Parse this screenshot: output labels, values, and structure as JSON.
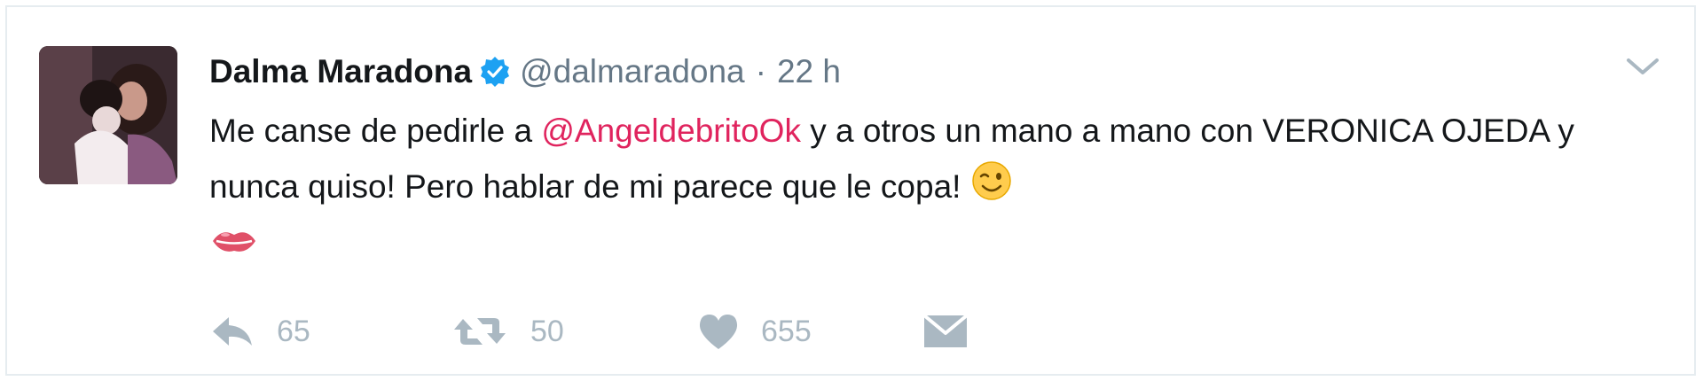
{
  "tweet": {
    "author": {
      "display_name": "Dalma Maradona",
      "screen_name": "@dalmaradona",
      "verified": true
    },
    "separator": "·",
    "timestamp": "22 h",
    "text": {
      "part1": "Me canse de pedirle a ",
      "mention": "@AngeldebritoOk",
      "part2": " y a otros un mano a mano con VERONICA OJEDA y nunca quiso! Pero hablar de mi parece que le copa! "
    },
    "emojis": [
      "winking-face-emoji",
      "kiss-mark-emoji"
    ],
    "actions": {
      "reply_count": "65",
      "retweet_count": "50",
      "like_count": "655"
    },
    "colors": {
      "mention": "#e0245e",
      "meta": "#657786",
      "action": "#aab8c2",
      "verified": "#1da1f2"
    }
  }
}
